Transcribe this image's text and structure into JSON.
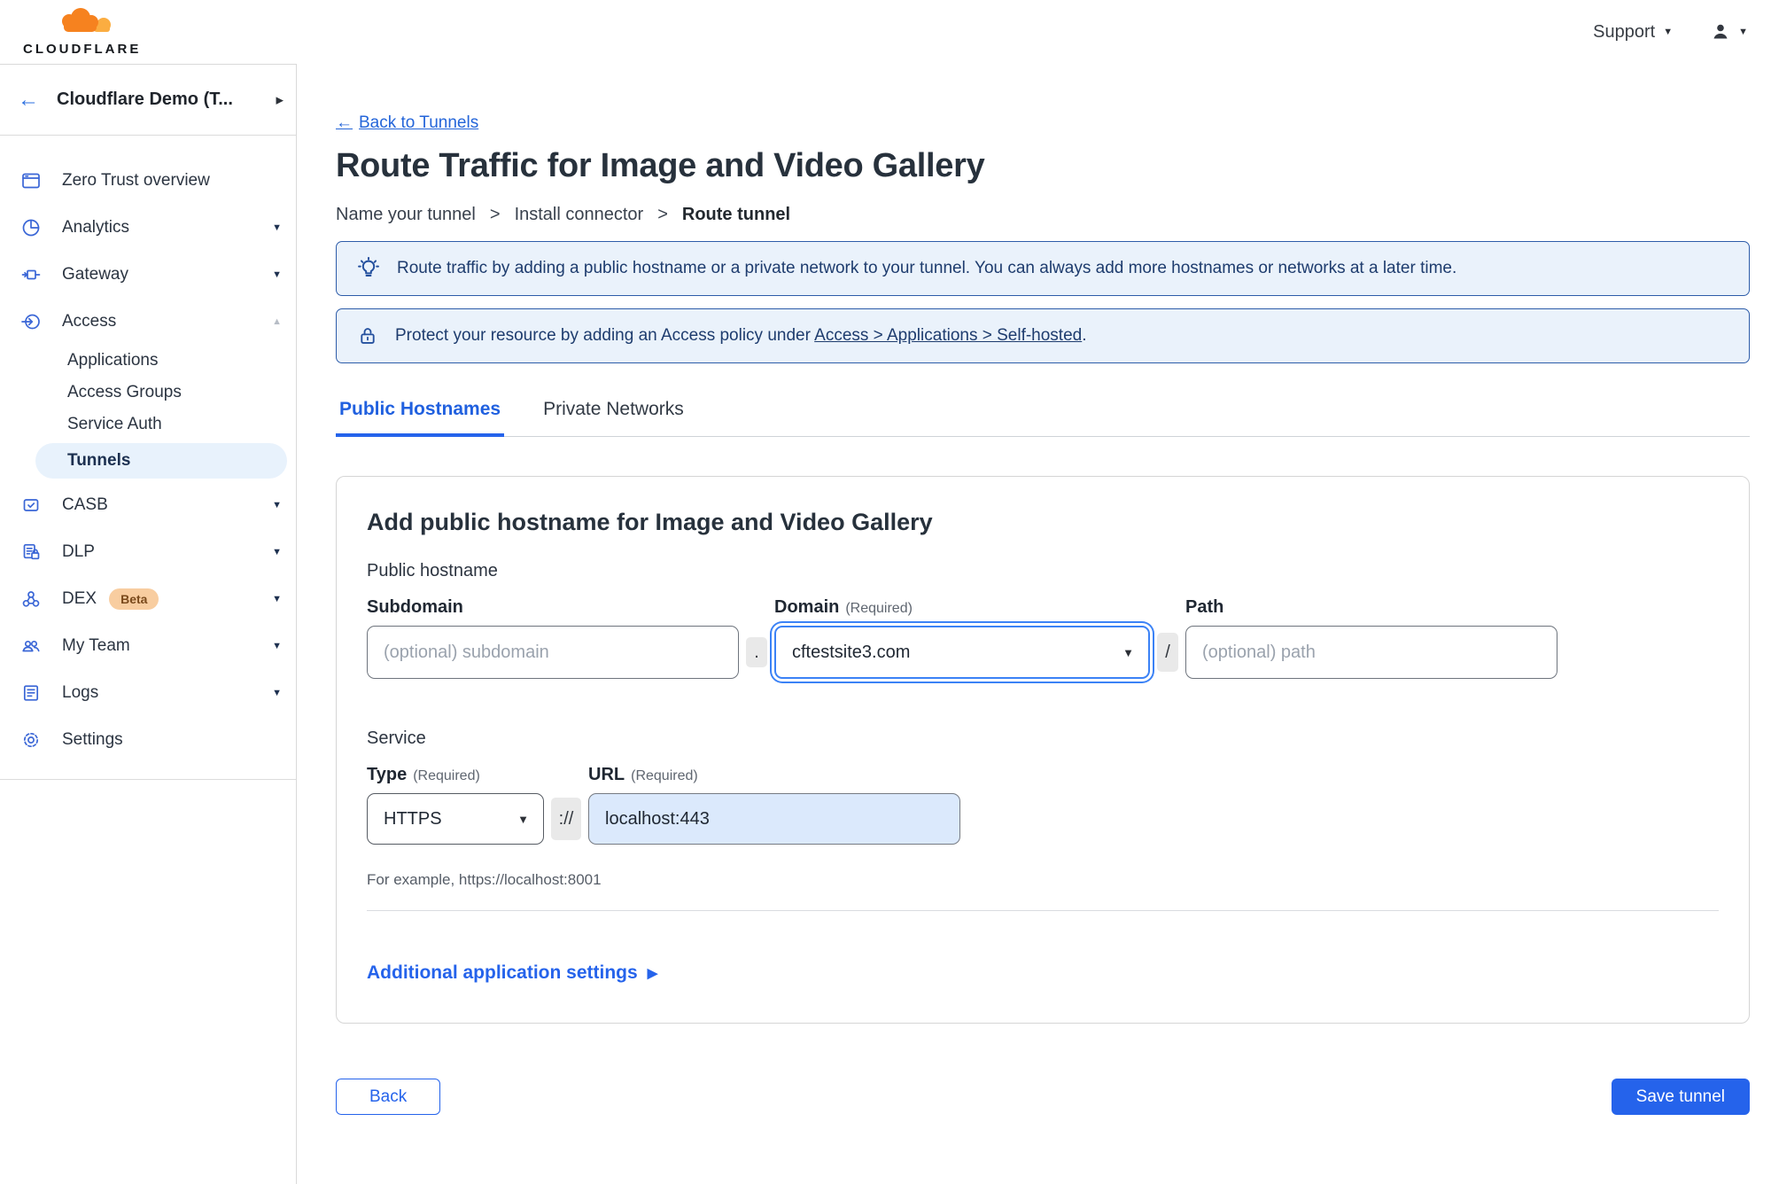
{
  "colors": {
    "accent_blue": "#2563eb",
    "link_blue": "#2465d9",
    "banner_bg": "#eaf2fb",
    "banner_border": "#2d5ca9",
    "banner_text": "#1e3c6e",
    "active_item_bg": "#e8f2fc",
    "beta_badge_bg": "#f8cda0",
    "beta_badge_text": "#7a4a1c",
    "brand_orange": "#f6821f",
    "brand_orange_light": "#fbad41",
    "url_field_bg": "#dbe9fc"
  },
  "icons": {
    "back_arrow": "←",
    "caret_down": "▼",
    "caret_up": "▲",
    "caret_right": "▸",
    "triangle_right": "▶"
  },
  "header": {
    "brand": "CLOUDFLARE",
    "support": "Support"
  },
  "sidebar": {
    "account_name": "Cloudflare Demo (T...",
    "items": [
      {
        "label": "Zero Trust overview",
        "icon": "window-icon"
      },
      {
        "label": "Analytics",
        "icon": "pie-chart-icon",
        "caret": "down"
      },
      {
        "label": "Gateway",
        "icon": "gateway-icon",
        "caret": "down"
      },
      {
        "label": "Access",
        "icon": "access-icon",
        "caret": "up",
        "expanded": true,
        "children": [
          {
            "label": "Applications"
          },
          {
            "label": "Access Groups"
          },
          {
            "label": "Service Auth"
          },
          {
            "label": "Tunnels",
            "active": true
          }
        ]
      },
      {
        "label": "CASB",
        "icon": "casb-icon",
        "caret": "down"
      },
      {
        "label": "DLP",
        "icon": "dlp-icon",
        "caret": "down"
      },
      {
        "label": "DEX",
        "icon": "dex-icon",
        "badge": "Beta",
        "caret": "down"
      },
      {
        "label": "My Team",
        "icon": "team-icon",
        "caret": "down"
      },
      {
        "label": "Logs",
        "icon": "logs-icon",
        "caret": "down"
      },
      {
        "label": "Settings",
        "icon": "gear-icon"
      }
    ]
  },
  "main": {
    "back_link": {
      "label": "Back to Tunnels"
    },
    "title": "Route Traffic for Image and Video Gallery",
    "step_separator": ">",
    "steps": [
      {
        "label": "Name your tunnel"
      },
      {
        "label": "Install connector"
      },
      {
        "label": "Route tunnel",
        "current": true
      }
    ],
    "banners": [
      {
        "icon": "lightbulb-icon",
        "text": "Route traffic by adding a public hostname or a private network to your tunnel. You can always add more hostnames or networks at a later time."
      },
      {
        "icon": "lock-icon",
        "text_before": "Protect your resource by adding an Access policy under ",
        "link": "Access > Applications > Self-hosted",
        "text_after": "."
      }
    ],
    "tabs": [
      {
        "label": "Public Hostnames",
        "active": true
      },
      {
        "label": "Private Networks"
      }
    ],
    "card": {
      "heading": "Add public hostname for Image and Video Gallery",
      "public_hostname_label": "Public hostname",
      "subdomain": {
        "label": "Subdomain",
        "placeholder": "(optional) subdomain"
      },
      "dot_separator": ".",
      "domain": {
        "label": "Domain",
        "required": "(Required)",
        "value": "cftestsite3.com"
      },
      "slash_separator": "/",
      "path": {
        "label": "Path",
        "placeholder": "(optional) path"
      },
      "service_label": "Service",
      "type": {
        "label": "Type",
        "required": "(Required)",
        "value": "HTTPS"
      },
      "url": {
        "label": "URL",
        "required": "(Required)",
        "scheme_separator": "://",
        "value": "localhost:443"
      },
      "example_text": "For example, https://localhost:8001",
      "additional_settings": "Additional application settings"
    },
    "footer": {
      "back": "Back",
      "save": "Save tunnel"
    }
  }
}
